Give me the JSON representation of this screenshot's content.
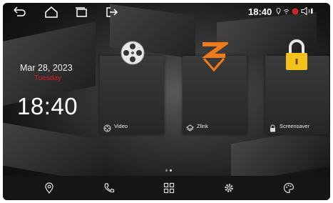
{
  "status_bar": {
    "time": "18:40",
    "nav_icons": [
      "back-icon",
      "home-icon",
      "recent-apps-icon",
      "exit-icon"
    ],
    "indicator_icons": [
      "location-icon",
      "wifi-icon",
      "record-icon",
      "volume-icon"
    ]
  },
  "clock_widget": {
    "date": "Mar 28, 2023",
    "weekday": "Tuesday",
    "time": "18:40"
  },
  "apps": [
    {
      "label": "Video",
      "icon": "film-reel-icon"
    },
    {
      "label": "Zlink",
      "icon": "zlink-icon"
    },
    {
      "label": "Screensaver",
      "icon": "lock-icon"
    }
  ],
  "page_indicator": {
    "current": 2,
    "total": 2
  },
  "dock": {
    "items": [
      "navigation-icon",
      "phone-icon",
      "apps-grid-icon",
      "settings-icon",
      "theme-icon"
    ]
  },
  "colors": {
    "accent_red": "#d2232a",
    "zlink_orange": "#f07a1a",
    "lock_yellow": "#f3c21b"
  }
}
